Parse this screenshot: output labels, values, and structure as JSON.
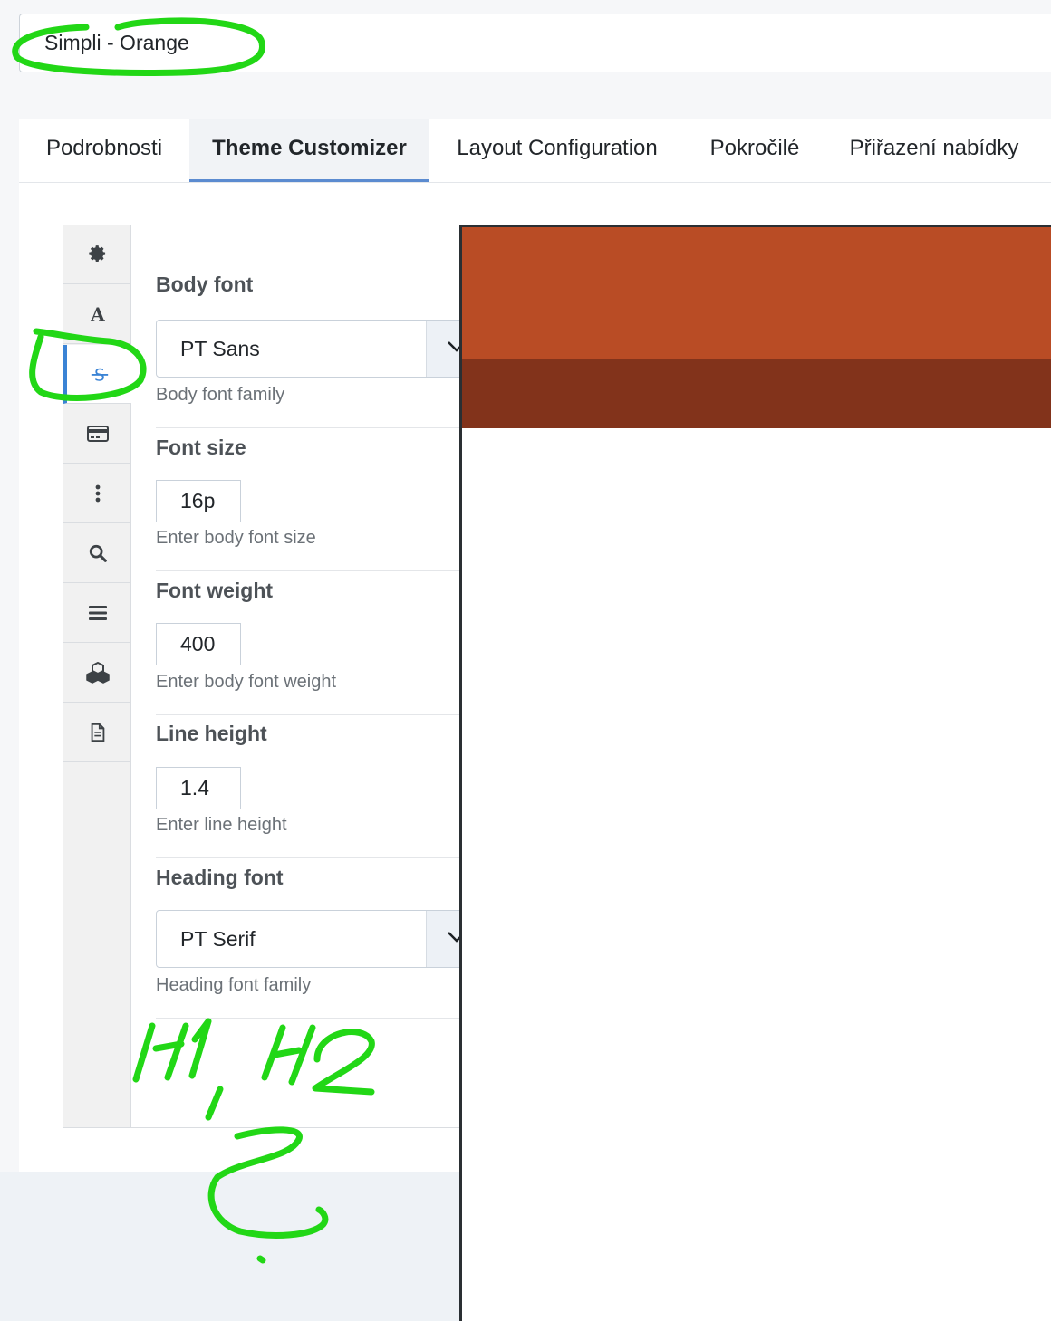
{
  "style_title": {
    "value": "Simpli - Orange"
  },
  "tabs": [
    {
      "label": "Podrobnosti",
      "active": false
    },
    {
      "label": "Theme Customizer",
      "active": true
    },
    {
      "label": "Layout Configuration",
      "active": false
    },
    {
      "label": "Pokročilé",
      "active": false
    },
    {
      "label": "Přiřazení nabídky",
      "active": false
    }
  ],
  "sidebar": {
    "items": [
      {
        "icon": "gear-icon"
      },
      {
        "icon": "font-icon"
      },
      {
        "icon": "strikethrough-icon",
        "active": true
      },
      {
        "icon": "credit-card-icon"
      },
      {
        "icon": "vertical-ellipsis-icon"
      },
      {
        "icon": "search-icon"
      },
      {
        "icon": "bars-icon"
      },
      {
        "icon": "cubes-icon"
      },
      {
        "icon": "file-icon"
      }
    ]
  },
  "fields": {
    "body_font": {
      "label": "Body font",
      "value": "PT Sans",
      "help": "Body font family"
    },
    "font_size": {
      "label": "Font size",
      "value": "16p",
      "help": "Enter body font size"
    },
    "font_weight": {
      "label": "Font weight",
      "value": "400",
      "help": "Enter body font weight"
    },
    "line_height": {
      "label": "Line height",
      "value": "1.4",
      "help": "Enter line height"
    },
    "heading_font": {
      "label": "Heading font",
      "value": "PT Serif",
      "help": "Heading font family"
    }
  },
  "preview": {
    "header_color": "#b94c25",
    "nav_color": "#82331b"
  },
  "colors": {
    "accent": "#3a83d5",
    "annotation": "#22d716"
  }
}
